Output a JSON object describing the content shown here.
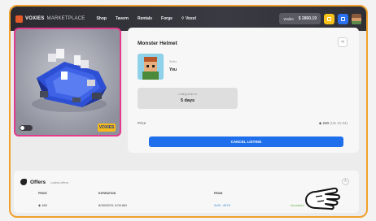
{
  "nav": {
    "brand": "VOXIES",
    "brand_sub": "MARKETPLACE",
    "links": [
      "Shop",
      "Tavern",
      "Rentals",
      "Forge",
      "Voxel"
    ],
    "wallet_label": "Wallet",
    "wallet_balance": "$ 2860.19"
  },
  "item": {
    "badge": "VOXIES",
    "title": "Monster Helmet",
    "owner_label": "Seller",
    "owner_name": "You",
    "ending_label": "Listing ends in",
    "ending_value": "5 days",
    "price_label": "Price",
    "price_value": "◈ 230",
    "price_usd": "(US 31.04)",
    "cancel_label": "CANCEL LISTING"
  },
  "offers": {
    "title": "Offers",
    "subtitle": "Latest offers",
    "columns": [
      "PRICE",
      "EXPIRATION",
      "FROM",
      ""
    ],
    "rows": [
      {
        "price": "◈ 180",
        "expiration": "8/18/2023, 9:00 AM",
        "from": "0x9f...4675",
        "status": "Accepted"
      }
    ]
  },
  "colors": {
    "accent": "#1f6fec",
    "frame": "#f0a02a",
    "image_border": "#e43b8e",
    "nav_bg": "#2a2a30"
  }
}
